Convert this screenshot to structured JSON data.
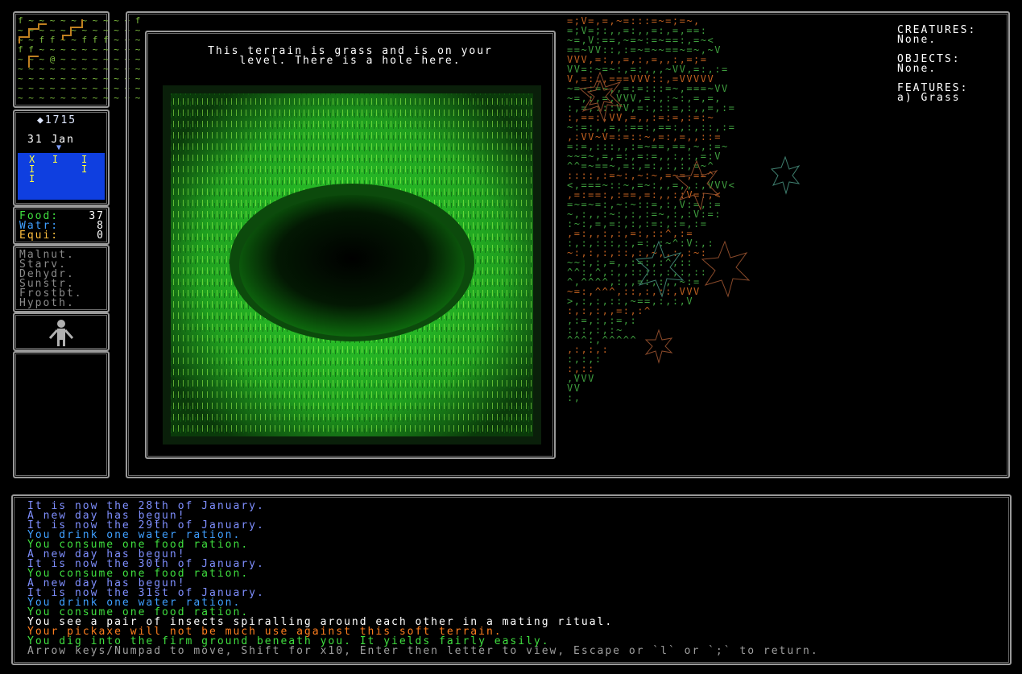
{
  "minimap": {
    "rows": [
      {
        "t": "f ~ ~ ~ ~ ~ ~ ~ ~ ~ ~ f",
        "c": "#7fbf3f"
      },
      {
        "t": "~ ~ ~ ~ ~ ~ ~ ~ ~ ~ ~ ~",
        "c": "#7fbf3f"
      },
      {
        "t": "~ ~ f f ~ ~ f f f ~ ~ ~",
        "c": "#7fbf3f"
      },
      {
        "t": "f f ~ ~ ~ ~ ~ ~ ~ ~ ~ ~",
        "c": "#7fbf3f"
      },
      {
        "t": "~ ~ ~ @ ~ ~ ~ ~ ~ ~ ~ ~",
        "c": "#7fbf3f"
      },
      {
        "t": "~ ~ ~ ~ ~ ~ ~ ~ ~ ~ ~ ~",
        "c": "#7fbf3f"
      },
      {
        "t": "~ ~ ~ ~ ~ ~ ~ ~ ~ ~ ~ ~",
        "c": "#7fbf3f"
      },
      {
        "t": "~ ~ ~ ~ ~ ~ ~ ~ ~ ~ ~ ~",
        "c": "#7fbf3f"
      },
      {
        "t": "~ ~ ~ ~ ~ ~ ~ ~ ~ ~ ~ ~",
        "c": "#7fbf3f"
      }
    ]
  },
  "date": {
    "coins": "◆1715",
    "date": "31 Jan",
    "marker": "▼",
    "weather_rows": [
      "X   I    I",
      "I        I",
      "I"
    ]
  },
  "stats": {
    "food_label": "Food:",
    "food_value": "37",
    "water_label": "Watr:",
    "water_value": "8",
    "equip_label": "Equi:",
    "equip_value": "0"
  },
  "conditions": [
    "Malnut.",
    "Starv.",
    "Dehydr.",
    "Sunstr.",
    "Frostbt.",
    "Hypoth."
  ],
  "inspect": {
    "line1": "This terrain is grass and is on your",
    "line2": "level. There is a hole here."
  },
  "info": {
    "creatures_label": "CREATURES:",
    "creatures_value": "None.",
    "objects_label": "OBJECTS:",
    "objects_value": "None.",
    "features_label": "FEATURES:",
    "features_value": "a) Grass"
  },
  "log": [
    {
      "t": "It is now the 28th of January.",
      "c": "#7f8fff"
    },
    {
      "t": "A new day has begun!",
      "c": "#7f8fff"
    },
    {
      "t": "It is now the 29th of January.",
      "c": "#7f8fff"
    },
    {
      "t": "You drink one water ration.",
      "c": "#3f9fff"
    },
    {
      "t": "You consume one food ration.",
      "c": "#3fdf3f"
    },
    {
      "t": "A new day has begun!",
      "c": "#7f8fff"
    },
    {
      "t": "It is now the 30th of January.",
      "c": "#7f8fff"
    },
    {
      "t": "You consume one food ration.",
      "c": "#3fdf3f"
    },
    {
      "t": "A new day has begun!",
      "c": "#7f8fff"
    },
    {
      "t": "It is now the 31st of January.",
      "c": "#7f8fff"
    },
    {
      "t": "You drink one water ration.",
      "c": "#3f9fff"
    },
    {
      "t": "You consume one food ration.",
      "c": "#3fdf3f"
    },
    {
      "t": "You see a pair of insects spiralling around each other in a mating ritual.",
      "c": "#ffffff"
    },
    {
      "t": "Your pickaxe will not be much use against this soft terrain.",
      "c": "#ff7f1f"
    },
    {
      "t": "You dig into the firm ground beneath you. It yields fairly easily.",
      "c": "#3fdf3f"
    },
    {
      "t": "Arrow keys/Numpad to move, Shift for x10, Enter then letter to view, Escape or `l` or `;` to return.",
      "c": "#9f9f9f"
    }
  ],
  "map": {
    "rows": [
      "=;V=,=,~=:::=~=;=~,",
      "=;V=;:,,=:,,=:,=,==:",
      "~=,V:==,~=~:=~==:,=~<",
      "==~VV::,:=~=~~==~=~,~V",
      "VVV,=:,,=,:,=,,:,=;=",
      "VV=:~=~:,=:,,,~VV,=:,:=",
      "V,=::,===VVV::,=VVVVV",
      "~=~:=~,,=:=:::=~,===~VV",
      "~=,:,=,VVV,=:,:~:,=,=,",
      ":,=,:::VV,=:,::=,:,,=,:=",
      ":,==:,VV,=,,:=:=,:=:~",
      "~:=:,,=,:==:,==:,:,::,:=",
      ",:VV~V=:=::~,=:,=,,::=",
      "=:=,:::,,:=~==,==,~,:=~",
      "~~=~,=,=:,=:=,,:,:,=:V",
      "^^=~==~,=:,=:,:,:,=~^",
      "::::,:=~:,~:~,=~=,==^",
      "<,===~::~,=~:,,=,,:,VVV<",
      ",=:==:,:==,=:,,::V=:,<",
      "=~=~=:,~:~::=,:,V:=,:=",
      "~,:,,:~:,:,:=~,:,:V:=:",
      ":~:,=,=:,:,:=:,:=,:=",
      ",=:,,:,:,=:,::^,:=",
      ":,:,:::,:,=:,:~^:V:,:",
      "~:,:,:,::,:,~,,:,:~:",
      "~~:,:,=,,:=:,:^,::",
      "^^:,^,:,,::::,:,:,::",
      "^,^^^^,:,,=:,:,,~:=",
      "~=:,^^^,::,:,::,VVV",
      ">,:,:,::,~==,:,:,V",
      ":,:,:,,=:,:^",
      ",:=,:,:=,:",
      ":,:,:,:~",
      "^^^:,^^^^^",
      ",:,:,:",
      ":,:,:",
      ":,::",
      ",VVV",
      "VV",
      ":,"
    ]
  },
  "colors": {
    "frame": "#8a8a8a",
    "food_label": "#3fdf3f",
    "water_label": "#3f9fff",
    "equip_label": "#ffbf3f",
    "conditions": "#8a8a8a",
    "sky": "#0f3fe0",
    "map_brown": "#c06020",
    "map_green": "#3f9f3f"
  }
}
